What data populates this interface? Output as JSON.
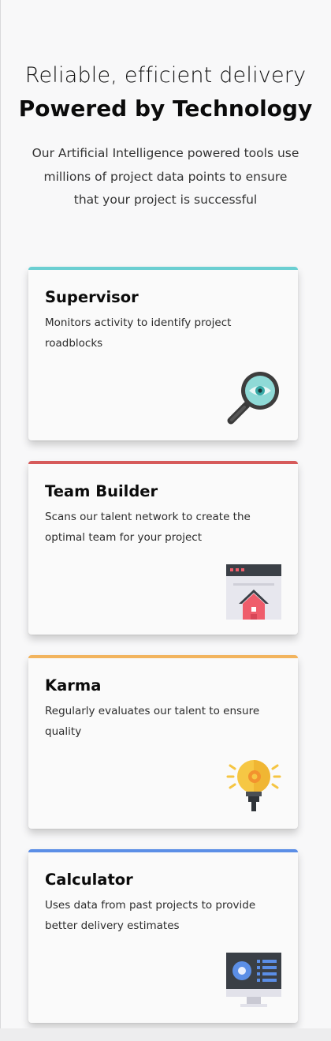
{
  "hero": {
    "line1": "Reliable, efficient delivery",
    "line2": "Powered by Technology",
    "description": "Our Artificial Intelligence powered tools use millions of project data points to ensure that your project is successful"
  },
  "cards": [
    {
      "title": "Supervisor",
      "description": "Monitors activity to identify project roadblocks",
      "accent_color": "#6bcfd2",
      "icon": "magnifier-eye-icon"
    },
    {
      "title": "Team Builder",
      "description": "Scans our talent network to create the optimal team for your project",
      "accent_color": "#d65a5a",
      "icon": "browser-house-icon"
    },
    {
      "title": "Karma",
      "description": "Regularly evaluates our talent to ensure quality",
      "accent_color": "#f2b45e",
      "icon": "lightbulb-gear-icon"
    },
    {
      "title": "Calculator",
      "description": "Uses data from past projects to provide better delivery estimates",
      "accent_color": "#5b8ee6",
      "icon": "monitor-dashboard-icon"
    }
  ]
}
